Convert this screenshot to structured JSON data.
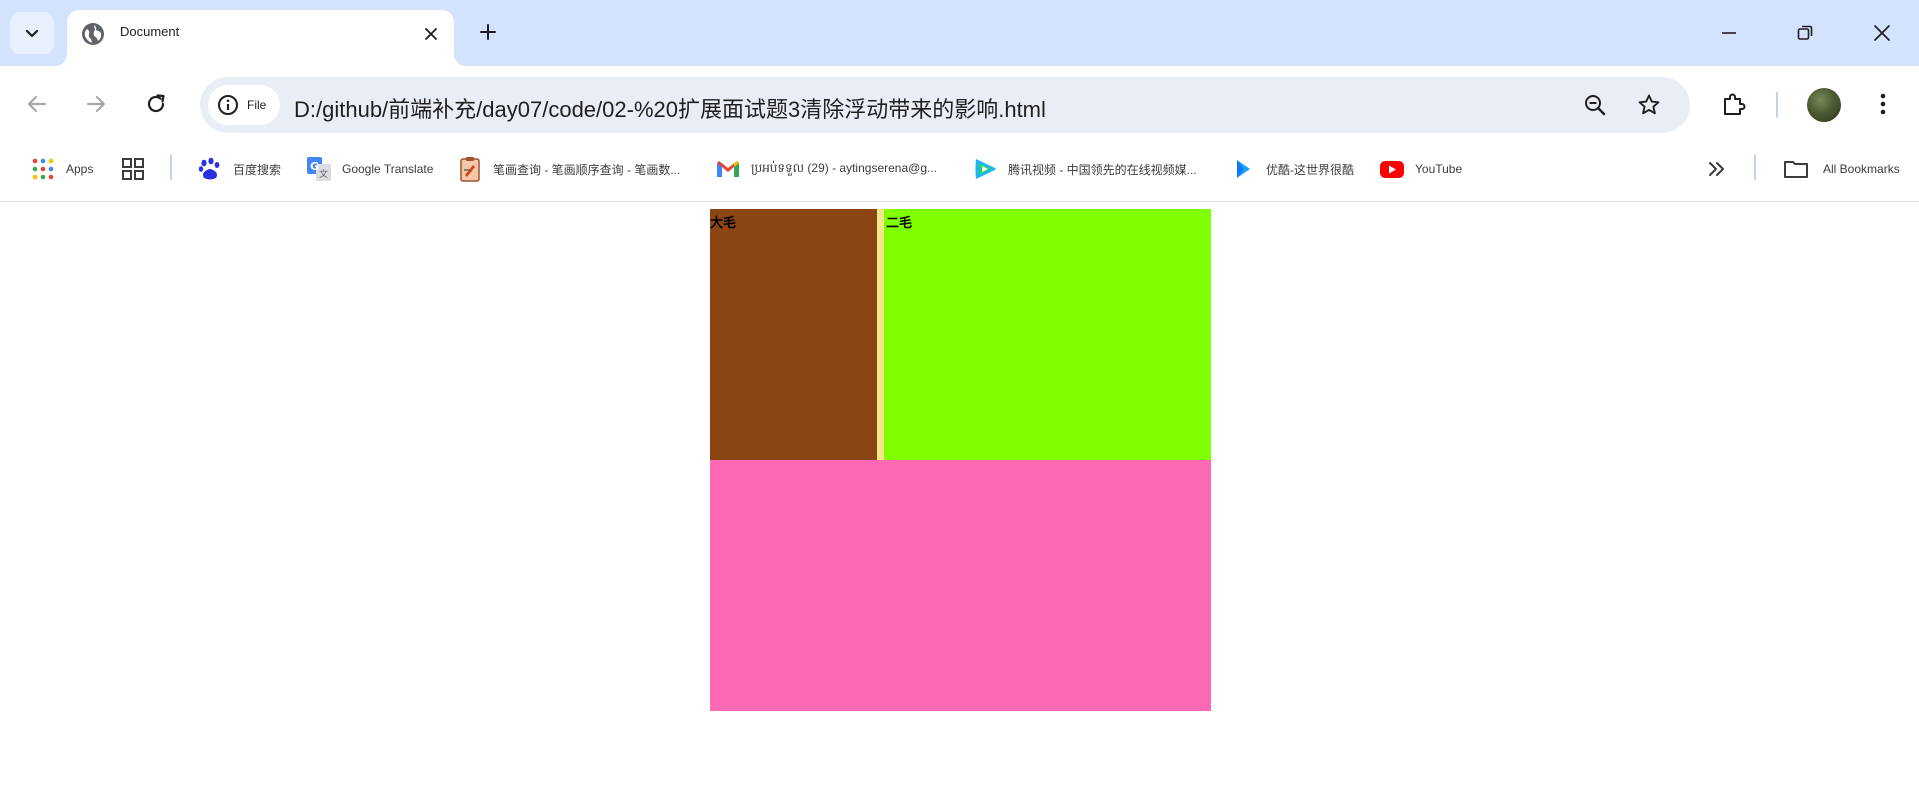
{
  "tab": {
    "title": "Document"
  },
  "omnibox": {
    "chip_label": "File",
    "url": "D:/github/前端补充/day07/code/02-%20扩展面试题3清除浮动带来的影响.html"
  },
  "bookmarks": {
    "items": [
      {
        "label": "Apps",
        "icon": "apps-grid-icon"
      },
      {
        "label": "",
        "icon": "tab-groups-icon"
      },
      {
        "label": "百度搜索",
        "icon": "baidu-paw-icon"
      },
      {
        "label": "Google Translate",
        "icon": "google-translate-icon"
      },
      {
        "label": "笔画查询 - 笔画顺序查询 - 笔画数...",
        "icon": "clipboard-icon"
      },
      {
        "label": "ប្រអប់ទទួល (29) - aytingserena@g...",
        "icon": "gmail-icon"
      },
      {
        "label": "腾讯视频 - 中国领先的在线视频媒...",
        "icon": "tencent-video-icon"
      },
      {
        "label": "优酷-这世界很酷",
        "icon": "youku-icon"
      },
      {
        "label": "YouTube",
        "icon": "youtube-icon"
      }
    ],
    "all_bookmarks_label": "All Bookmarks"
  },
  "page": {
    "box1_label": "大毛",
    "box2_label": "二毛"
  },
  "colors": {
    "tabstrip": "#d3e3fd",
    "box1": "#8b4513",
    "gap": "#f0e68c",
    "box2": "#7fff00",
    "box3": "#ff69b4"
  }
}
